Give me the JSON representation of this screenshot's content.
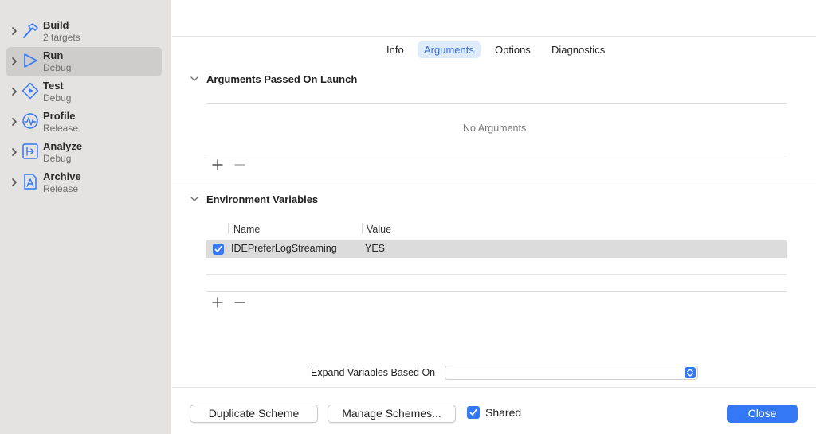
{
  "sidebar": {
    "actions": [
      {
        "name": "Build",
        "subtitle": "2 targets",
        "icon": "hammer-icon"
      },
      {
        "name": "Run",
        "subtitle": "Debug",
        "icon": "play-icon",
        "selected": true
      },
      {
        "name": "Test",
        "subtitle": "Debug",
        "icon": "test-diamond-icon"
      },
      {
        "name": "Profile",
        "subtitle": "Release",
        "icon": "waveform-icon"
      },
      {
        "name": "Analyze",
        "subtitle": "Debug",
        "icon": "analyze-icon"
      },
      {
        "name": "Archive",
        "subtitle": "Release",
        "icon": "archive-icon"
      }
    ]
  },
  "tabs": [
    {
      "label": "Info"
    },
    {
      "label": "Arguments",
      "active": true
    },
    {
      "label": "Options"
    },
    {
      "label": "Diagnostics"
    }
  ],
  "arguments_section": {
    "title": "Arguments Passed On Launch",
    "empty_text": "No Arguments"
  },
  "env_section": {
    "title": "Environment Variables",
    "columns": {
      "name": "Name",
      "value": "Value"
    },
    "rows": [
      {
        "enabled": true,
        "name": "IDEPreferLogStreaming",
        "value": "YES"
      }
    ]
  },
  "expand": {
    "label": "Expand Variables Based On",
    "value": ""
  },
  "footer": {
    "duplicate_label": "Duplicate Scheme",
    "manage_label": "Manage Schemes...",
    "shared_label": "Shared",
    "shared_checked": true,
    "close_label": "Close"
  },
  "colors": {
    "accent": "#3478f6",
    "sidebar_bg": "#e5e3e1",
    "selected_bg": "#cfcdcb",
    "tab_active_bg": "#deebfb"
  }
}
